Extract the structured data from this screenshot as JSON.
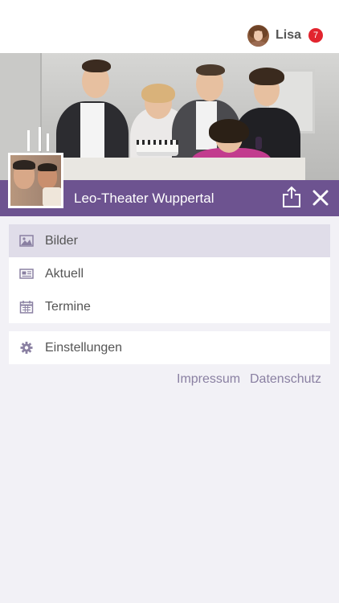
{
  "header": {
    "user_name": "Lisa",
    "notification_count": "7",
    "avatar_icon": "user-avatar"
  },
  "group": {
    "title": "Leo-Theater Wuppertal",
    "share_icon": "share-icon",
    "close_icon": "close-icon"
  },
  "menu": {
    "items": [
      {
        "label": "Bilder",
        "icon": "image-icon",
        "selected": true
      },
      {
        "label": "Aktuell",
        "icon": "newspaper-icon",
        "selected": false
      },
      {
        "label": "Termine",
        "icon": "calendar-icon",
        "selected": false
      }
    ],
    "settings": {
      "label": "Einstellungen",
      "icon": "gear-icon"
    }
  },
  "footer": {
    "impressum": "Impressum",
    "datenschutz": "Datenschutz"
  },
  "colors": {
    "accent": "#6d5390",
    "selected_row": "#e0dde9",
    "background": "#f2f1f6",
    "badge": "#e2242e",
    "link": "#8a80a2"
  }
}
